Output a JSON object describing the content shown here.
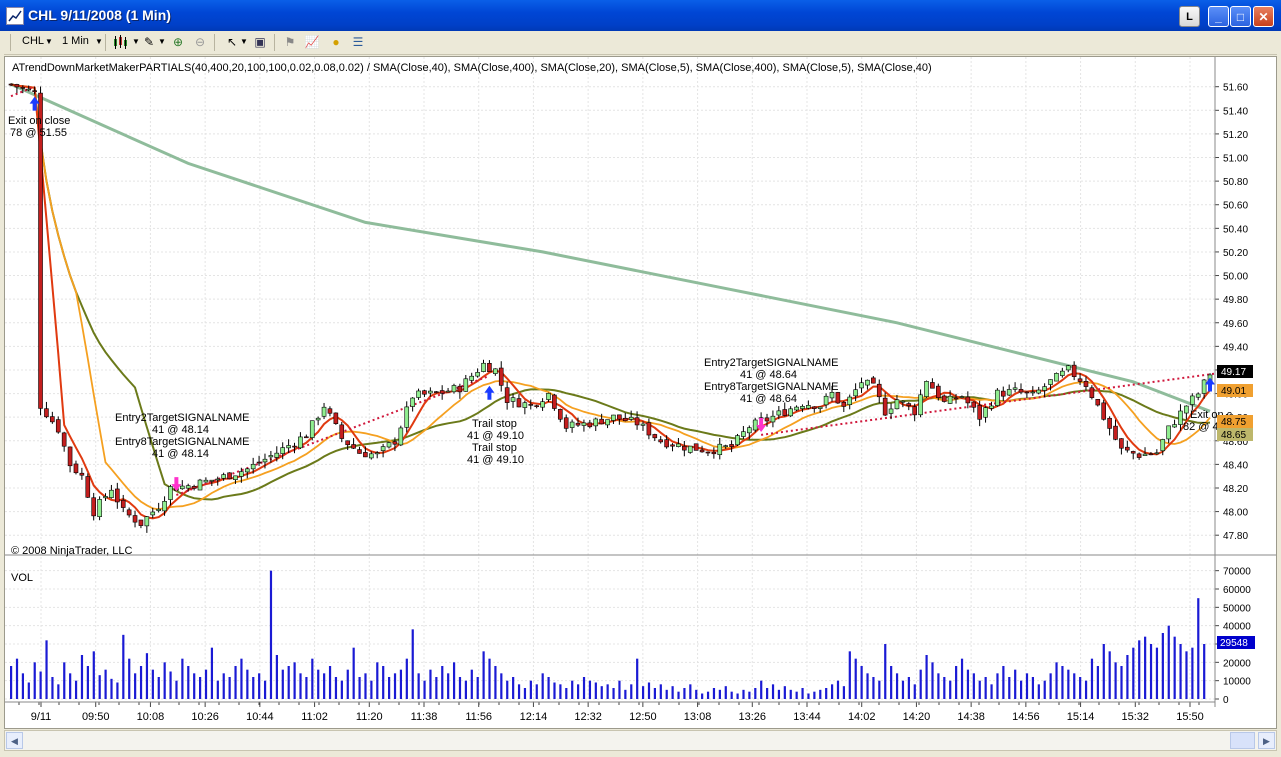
{
  "window": {
    "title": "CHL  9/11/2008 (1 Min)",
    "btn_l": "L",
    "btn_min": "_",
    "btn_max": "□",
    "btn_close": "✕"
  },
  "toolbar": {
    "instrument": "CHL",
    "interval": "1 Min"
  },
  "chart": {
    "header": "ATrendDownMarketMakerPARTIALS(40,400,20,100,100,0.02,0.08,0.02) / SMA(Close,40), SMA(Close,400), SMA(Close,20), SMA(Close,5), SMA(Close,400), SMA(Close,5), SMA(Close,40)",
    "copyright": "© 2008 NinjaTrader, LLC",
    "vol_label": "VOL",
    "annotations": {
      "exit1": "Exit on close",
      "exit1_qty": "78 @ 51.55",
      "entry2a": "Entry2TargetSIGNALNAME",
      "entry2a_qty": "41 @ 48.14",
      "entry8a": "Entry8TargetSIGNALNAME",
      "entry8a_qty": "41 @ 48.14",
      "trail1": "Trail stop",
      "trail1_qty": "41 @ 49.10",
      "trail2": "Trail stop",
      "trail2_qty": "41 @ 49.10",
      "entry2b": "Entry2TargetSIGNALNAME",
      "entry2b_qty": "41 @ 48.64",
      "entry8b": "Entry8TargetSIGNALNAME",
      "entry8b_qty": "41 @ 48.64",
      "exit2": "Exit on c",
      "exit2_qty": "82 @ 4"
    },
    "price_badges": [
      {
        "text": "49.17",
        "bg": "#000000",
        "fg": "#ffffff"
      },
      {
        "text": "49.01",
        "bg": "#f0a030",
        "fg": "#000000"
      },
      {
        "text": "48.75",
        "bg": "#f0a030",
        "fg": "#000000"
      },
      {
        "text": "48.65",
        "bg": "#bdb76b",
        "fg": "#000000"
      }
    ],
    "vol_badge": {
      "text": "29548",
      "bg": "#0000cc",
      "fg": "#ffffff"
    }
  },
  "chart_data": {
    "type": "candlestick",
    "title": "",
    "price_axis_ticks": [
      "51.60",
      "51.40",
      "51.20",
      "51.00",
      "50.80",
      "50.60",
      "50.40",
      "50.20",
      "50.00",
      "49.80",
      "49.60",
      "49.40",
      "49.20",
      "49.00",
      "48.80",
      "48.60",
      "48.40",
      "48.20",
      "48.00",
      "47.80"
    ],
    "ylim": [
      47.7,
      51.75
    ],
    "volume_axis_ticks": [
      "70000",
      "60000",
      "50000",
      "40000",
      "30000",
      "20000",
      "10000",
      "0"
    ],
    "vol_ylim": [
      0,
      72000
    ],
    "time_ticks": [
      "9/11",
      "09:50",
      "10:08",
      "10:26",
      "10:44",
      "11:02",
      "11:20",
      "11:38",
      "11:56",
      "12:14",
      "12:32",
      "12:50",
      "13:08",
      "13:26",
      "13:44",
      "14:02",
      "14:20",
      "14:38",
      "14:56",
      "15:14",
      "15:32",
      "15:50"
    ],
    "price_series": [
      [
        0,
        51.62
      ],
      [
        4,
        51.55
      ],
      [
        5,
        48.9
      ],
      [
        8,
        48.7
      ],
      [
        10,
        48.4
      ],
      [
        12,
        48.3
      ],
      [
        14,
        48.0
      ],
      [
        17,
        48.2
      ],
      [
        19,
        48.0
      ],
      [
        22,
        47.9
      ],
      [
        25,
        48.05
      ],
      [
        27,
        48.2
      ],
      [
        30,
        48.22
      ],
      [
        35,
        48.28
      ],
      [
        40,
        48.36
      ],
      [
        45,
        48.5
      ],
      [
        50,
        48.65
      ],
      [
        53,
        48.9
      ],
      [
        56,
        48.62
      ],
      [
        59,
        48.5
      ],
      [
        62,
        48.48
      ],
      [
        65,
        48.6
      ],
      [
        68,
        48.98
      ],
      [
        72,
        49.0
      ],
      [
        76,
        49.05
      ],
      [
        80,
        49.25
      ],
      [
        82,
        49.2
      ],
      [
        84,
        48.95
      ],
      [
        88,
        48.9
      ],
      [
        91,
        49.0
      ],
      [
        94,
        48.72
      ],
      [
        98,
        48.75
      ],
      [
        102,
        48.8
      ],
      [
        106,
        48.75
      ],
      [
        110,
        48.6
      ],
      [
        114,
        48.55
      ],
      [
        118,
        48.52
      ],
      [
        122,
        48.55
      ],
      [
        125,
        48.72
      ],
      [
        128,
        48.78
      ],
      [
        131,
        48.85
      ],
      [
        134,
        48.92
      ],
      [
        137,
        48.9
      ],
      [
        139,
        49.0
      ],
      [
        141,
        48.88
      ],
      [
        144,
        49.1
      ],
      [
        146,
        49.05
      ],
      [
        148,
        48.85
      ],
      [
        150,
        48.95
      ],
      [
        153,
        48.85
      ],
      [
        155,
        49.12
      ],
      [
        158,
        48.92
      ],
      [
        161,
        48.98
      ],
      [
        164,
        48.8
      ],
      [
        167,
        49.0
      ],
      [
        170,
        49.02
      ],
      [
        173,
        48.98
      ],
      [
        176,
        49.1
      ],
      [
        179,
        49.2
      ],
      [
        182,
        49.08
      ],
      [
        185,
        48.8
      ],
      [
        188,
        48.52
      ],
      [
        191,
        48.48
      ],
      [
        194,
        48.5
      ],
      [
        196,
        48.7
      ],
      [
        199,
        48.9
      ],
      [
        201,
        49.0
      ],
      [
        203,
        49.17
      ]
    ],
    "sma_slow_400": [
      [
        0,
        51.62
      ],
      [
        30,
        50.95
      ],
      [
        60,
        50.45
      ],
      [
        90,
        50.2
      ],
      [
        120,
        49.9
      ],
      [
        150,
        49.6
      ],
      [
        170,
        49.35
      ],
      [
        190,
        49.1
      ],
      [
        203,
        48.85
      ]
    ],
    "entries": [
      {
        "time_index": 28,
        "price": 48.14
      },
      {
        "time_index": 127,
        "price": 48.64
      }
    ],
    "exits": [
      {
        "time_index": 4,
        "price": 51.55,
        "label": "Exit on close"
      },
      {
        "time_index": 81,
        "price": 49.1,
        "label": "Trail stop"
      },
      {
        "time_index": 203,
        "price": 49.17,
        "label": "Exit on close"
      }
    ],
    "volume": [
      18,
      22,
      14,
      9,
      20,
      15,
      32,
      12,
      8,
      20,
      14,
      10,
      24,
      18,
      26,
      13,
      16,
      11,
      9,
      35,
      22,
      14,
      18,
      25,
      16,
      12,
      20,
      15,
      10,
      22,
      18,
      14,
      12,
      16,
      28,
      10,
      14,
      12,
      18,
      22,
      16,
      12,
      14,
      10,
      70,
      24,
      16,
      18,
      20,
      14,
      12,
      22,
      16,
      14,
      18,
      12,
      10,
      16,
      28,
      12,
      14,
      10,
      20,
      18,
      12,
      14,
      16,
      22,
      38,
      14,
      10,
      16,
      12,
      18,
      14,
      20,
      12,
      10,
      16,
      12,
      26,
      22,
      18,
      14,
      10,
      12,
      8,
      6,
      10,
      8,
      14,
      12,
      9,
      8,
      6,
      10,
      8,
      12,
      10,
      9,
      7,
      8,
      6,
      10,
      5,
      8,
      22,
      7,
      9,
      6,
      8,
      5,
      7,
      4,
      6,
      8,
      5,
      3,
      4,
      6,
      5,
      7,
      4,
      3,
      5,
      4,
      6,
      10,
      6,
      8,
      5,
      7,
      5,
      4,
      6,
      3,
      4,
      5,
      6,
      8,
      10,
      7,
      26,
      22,
      18,
      14,
      12,
      10,
      30,
      18,
      14,
      10,
      12,
      8,
      16,
      24,
      20,
      14,
      12,
      10,
      18,
      22,
      16,
      14,
      10,
      12,
      8,
      14,
      18,
      12,
      16,
      10,
      14,
      12,
      8,
      10,
      14,
      20,
      18,
      16,
      14,
      12,
      10,
      22,
      18,
      30,
      26,
      20,
      18,
      24,
      28,
      32,
      34,
      30,
      28,
      36,
      40,
      34,
      30,
      26,
      28,
      55,
      30
    ]
  }
}
